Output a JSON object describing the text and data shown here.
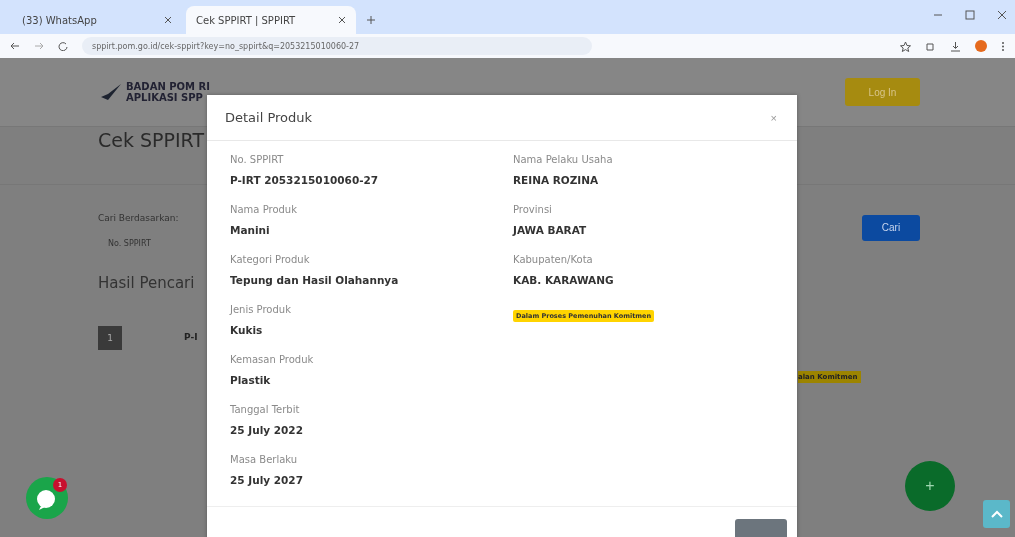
{
  "browser": {
    "tabs": [
      {
        "title": "(33) WhatsApp",
        "selected": false
      },
      {
        "title": "Cek SPPIRT | SPPIRT",
        "selected": true
      }
    ],
    "url": "sppirt.pom.go.id/cek-sppirt?key=no_sppirt&q=2053215010060-27"
  },
  "page": {
    "logo_title": "BADAN POM RI",
    "logo_subtitle": "APLIKASI SPP",
    "login_button": "Log In",
    "heading": "Cek SPPIRT",
    "search_label": "Cari Berdasarkan:",
    "search_select": "No. SPPIRT",
    "search_button": "Cari",
    "results_heading": "Hasil Pencari",
    "result": {
      "number": "1",
      "code": "P-I",
      "status": "alan Komitmen"
    }
  },
  "modal": {
    "title": "Detail Produk",
    "close": "×",
    "left_fields": [
      {
        "label": "No. SPPIRT",
        "value": "P-IRT 2053215010060-27"
      },
      {
        "label": "Nama Produk",
        "value": "Manini"
      },
      {
        "label": "Kategori Produk",
        "value": "Tepung dan Hasil Olahannya"
      },
      {
        "label": "Jenis Produk",
        "value": "Kukis"
      },
      {
        "label": "Kemasan Produk",
        "value": "Plastik"
      },
      {
        "label": "Tanggal Terbit",
        "value": "25 July 2022"
      },
      {
        "label": "Masa Berlaku",
        "value": "25 July 2027"
      }
    ],
    "right_fields": [
      {
        "label": "Nama Pelaku Usaha",
        "value": "REINA ROZINA"
      },
      {
        "label": "Provinsi",
        "value": "JAWA BARAT"
      },
      {
        "label": "Kabupaten/Kota",
        "value": "KAB. KARAWANG"
      }
    ],
    "status_badge": "Dalam Proses Pemenuhan Komitmen"
  },
  "fab": {
    "label": "+"
  },
  "chat_badge": {
    "count": "1"
  }
}
